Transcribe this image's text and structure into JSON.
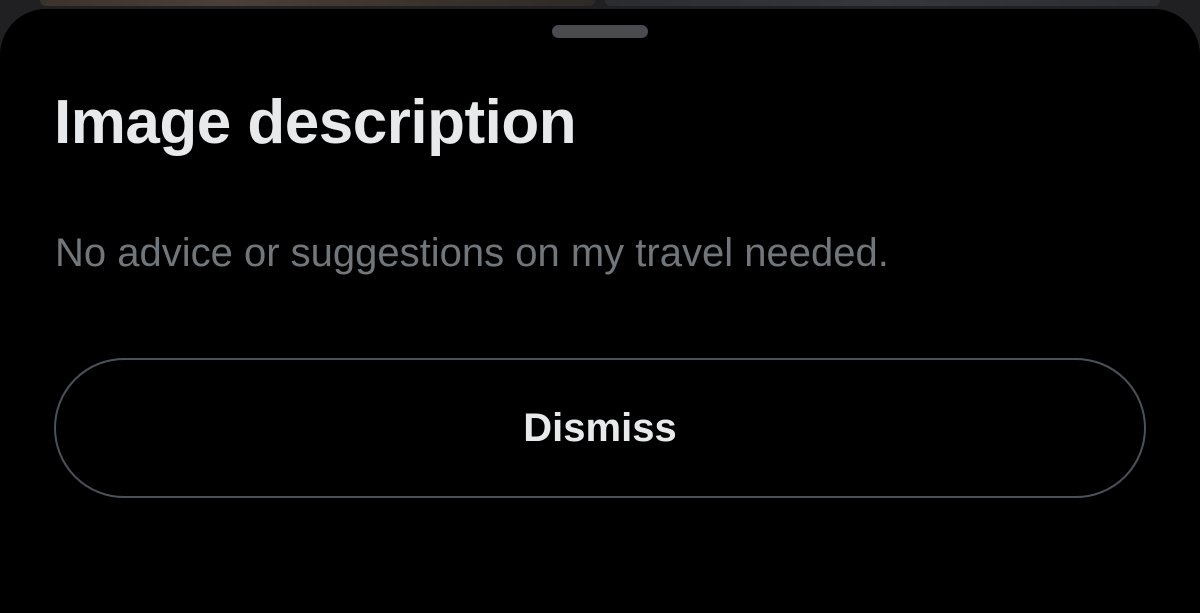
{
  "sheet": {
    "title": "Image description",
    "description": "No advice or suggestions on my travel needed.",
    "dismiss_label": "Dismiss"
  },
  "colors": {
    "sheet_background": "#000000",
    "title_text": "#e7e9ea",
    "description_text": "#71767b",
    "button_border": "#4a5259",
    "handle": "#4a4b4f"
  }
}
